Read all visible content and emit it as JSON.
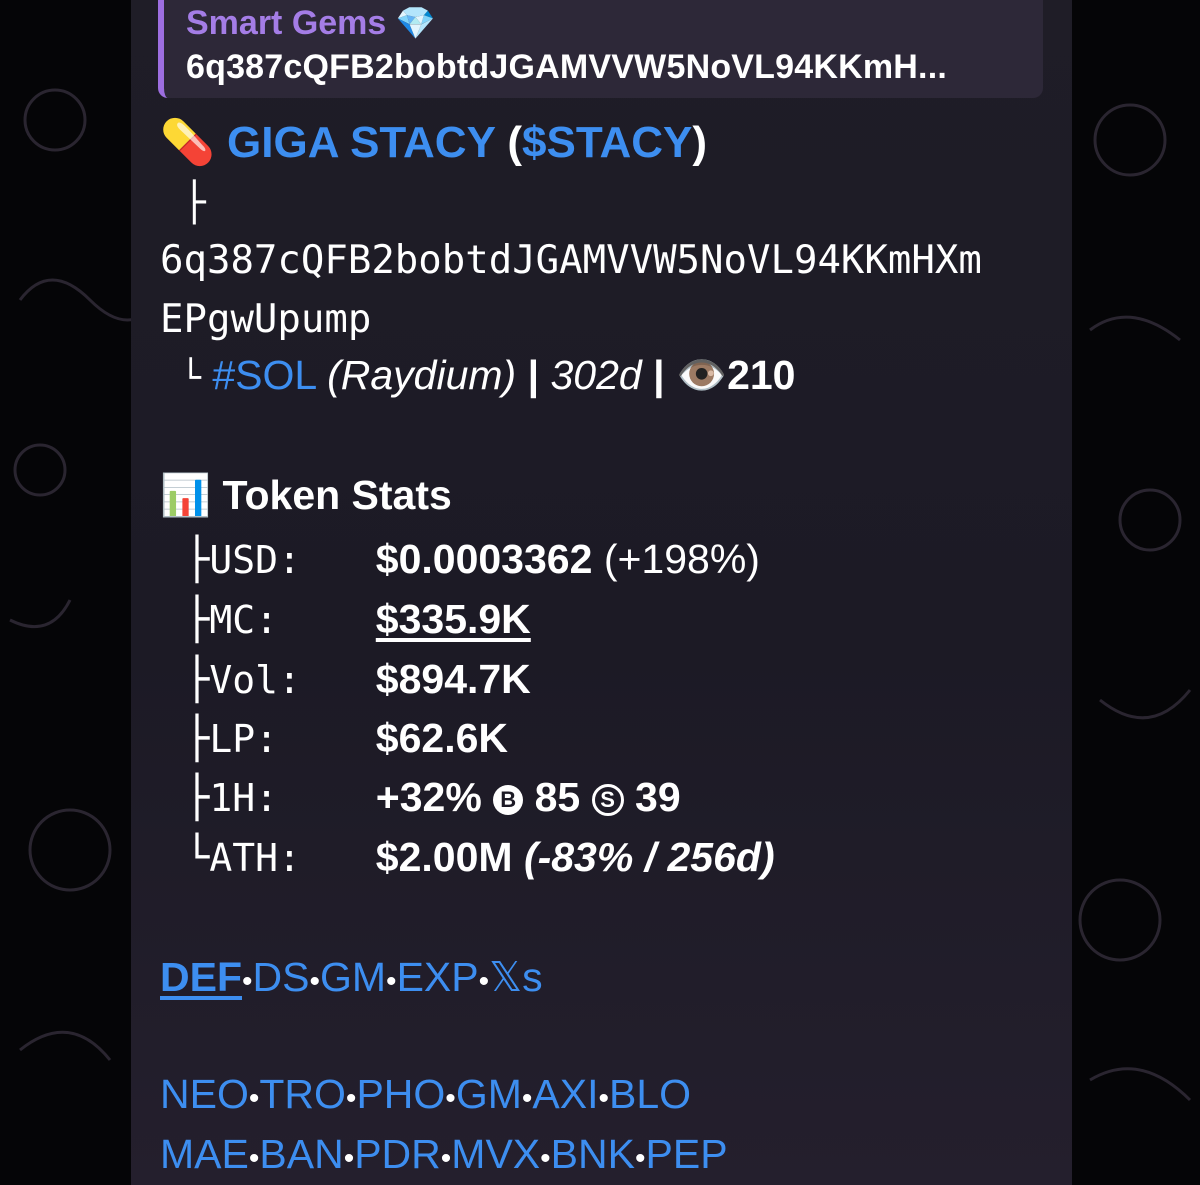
{
  "quote": {
    "title": "Smart Gems",
    "address": "6q387cQFB2bobtdJGAMVVW5NoVL94KKmH..."
  },
  "token": {
    "name": "GIGA STACY",
    "ticker": "$STACY",
    "address_line1": "6q387cQFB2bobtdJGAMVVW5NoVL94KKmHXm",
    "address_line2": "EPgwUpump",
    "chain": "#SOL",
    "dex": "(Raydium)",
    "age": "302d",
    "views": "210"
  },
  "stats": {
    "heading": "Token Stats",
    "rows": [
      {
        "label": "USD:",
        "value": "$0.0003362",
        "extra": "(+198%)"
      },
      {
        "label": "MC:",
        "value": "$335.9K",
        "extra": ""
      },
      {
        "label": "Vol:",
        "value": "$894.7K",
        "extra": ""
      },
      {
        "label": "LP:",
        "value": "$62.6K",
        "extra": ""
      },
      {
        "label": "1H:",
        "value": "+32%",
        "buys": "85",
        "sells": "39"
      },
      {
        "label": "ATH:",
        "value": "$2.00M",
        "extra": "(-83% / 256d)"
      }
    ]
  },
  "links": {
    "primary": [
      "DEF",
      "DS",
      "GM",
      "EXP",
      "𝕏s"
    ],
    "row1": [
      "NEO",
      "TRO",
      "PHO",
      "GM",
      "AXI",
      "BLO"
    ],
    "row2": [
      "MAE",
      "BAN",
      "PDR",
      "MVX",
      "BNK",
      "PEP"
    ]
  },
  "colors": {
    "accent_blue": "#3d8ef0",
    "quote_purple": "#a47de6",
    "bubble_bg": "#1f1d27"
  },
  "icons": {
    "pill": "pill-icon",
    "gem": "gem-icon",
    "eye": "eye-icon",
    "chart": "bar-chart-icon"
  }
}
